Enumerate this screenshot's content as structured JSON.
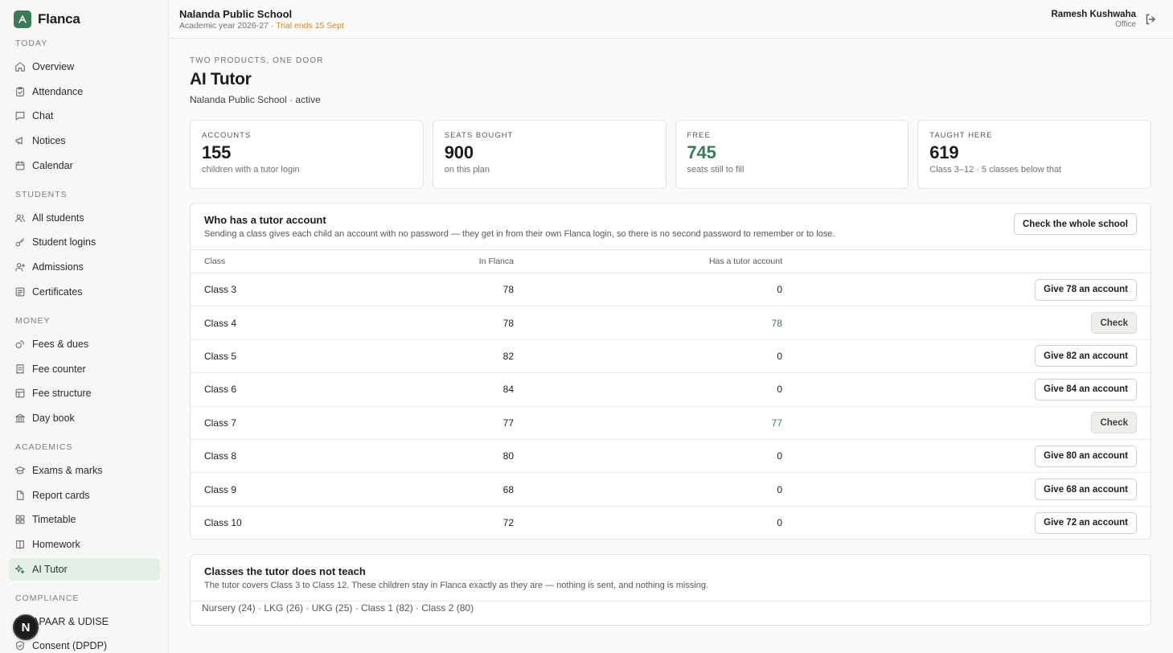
{
  "brand": {
    "name": "Flanca",
    "accent": "#3d7a56"
  },
  "header": {
    "school_name": "Nalanda Public School",
    "academic_year": "Academic year 2026-27",
    "separator": " · ",
    "trial": "Trial ends 15 Sept",
    "user_name": "Ramesh Kushwaha",
    "user_role": "Office"
  },
  "sidebar": {
    "sections": [
      {
        "label": "Today",
        "items": [
          {
            "label": "Overview",
            "icon": "home-icon"
          },
          {
            "label": "Attendance",
            "icon": "clipboard-check-icon"
          },
          {
            "label": "Chat",
            "icon": "chat-icon"
          },
          {
            "label": "Notices",
            "icon": "megaphone-icon"
          },
          {
            "label": "Calendar",
            "icon": "calendar-icon"
          }
        ]
      },
      {
        "label": "Students",
        "items": [
          {
            "label": "All students",
            "icon": "users-icon"
          },
          {
            "label": "Student logins",
            "icon": "key-icon"
          },
          {
            "label": "Admissions",
            "icon": "user-plus-icon"
          },
          {
            "label": "Certificates",
            "icon": "certificate-icon"
          }
        ]
      },
      {
        "label": "Money",
        "items": [
          {
            "label": "Fees & dues",
            "icon": "coins-icon"
          },
          {
            "label": "Fee counter",
            "icon": "receipt-icon"
          },
          {
            "label": "Fee structure",
            "icon": "table-icon"
          },
          {
            "label": "Day book",
            "icon": "bank-icon"
          }
        ]
      },
      {
        "label": "Academics",
        "items": [
          {
            "label": "Exams & marks",
            "icon": "graduation-cap-icon"
          },
          {
            "label": "Report cards",
            "icon": "document-icon"
          },
          {
            "label": "Timetable",
            "icon": "grid-icon"
          },
          {
            "label": "Homework",
            "icon": "book-icon"
          },
          {
            "label": "AI Tutor",
            "icon": "sparkles-icon",
            "active": true
          }
        ]
      },
      {
        "label": "Compliance",
        "items": [
          {
            "label": "APAAR & UDISE",
            "icon": "id-card-icon"
          },
          {
            "label": "Consent (DPDP)",
            "icon": "shield-check-icon"
          }
        ]
      }
    ],
    "avatar_letter": "N"
  },
  "page": {
    "eyebrow": "Two products, one door",
    "title": "AI Tutor",
    "subtitle": "Nalanda Public School · active"
  },
  "stats": [
    {
      "label": "Accounts",
      "value": "155",
      "note": "children with a tutor login"
    },
    {
      "label": "Seats bought",
      "value": "900",
      "note": "on this plan"
    },
    {
      "label": "Free",
      "value": "745",
      "note": "seats still to fill",
      "highlight": true
    },
    {
      "label": "Taught here",
      "value": "619",
      "note": "Class 3–12 · 5 classes below that"
    }
  ],
  "accounts_card": {
    "title": "Who has a tutor account",
    "description": "Sending a class gives each child an account with no password — they get in from their own Flanca login, so there is no second password to remember or to lose.",
    "check_all_label": "Check the whole school",
    "columns": {
      "class": "Class",
      "in_flanca": "In Flanca",
      "has_account": "Has a tutor account"
    },
    "rows": [
      {
        "class": "Class 3",
        "in_flanca": "78",
        "has_account": "0",
        "action": "Give 78 an account",
        "done": false
      },
      {
        "class": "Class 4",
        "in_flanca": "78",
        "has_account": "78",
        "action": "Check",
        "done": true
      },
      {
        "class": "Class 5",
        "in_flanca": "82",
        "has_account": "0",
        "action": "Give 82 an account",
        "done": false
      },
      {
        "class": "Class 6",
        "in_flanca": "84",
        "has_account": "0",
        "action": "Give 84 an account",
        "done": false
      },
      {
        "class": "Class 7",
        "in_flanca": "77",
        "has_account": "77",
        "action": "Check",
        "done": true
      },
      {
        "class": "Class 8",
        "in_flanca": "80",
        "has_account": "0",
        "action": "Give 80 an account",
        "done": false
      },
      {
        "class": "Class 9",
        "in_flanca": "68",
        "has_account": "0",
        "action": "Give 68 an account",
        "done": false
      },
      {
        "class": "Class 10",
        "in_flanca": "72",
        "has_account": "0",
        "action": "Give 72 an account",
        "done": false
      }
    ]
  },
  "not_taught_card": {
    "title": "Classes the tutor does not teach",
    "description": "The tutor covers Class 3 to Class 12. These children stay in Flanca exactly as they are — nothing is sent, and nothing is missing.",
    "list": "Nursery (24) · LKG (26) · UKG (25) · Class 1 (82) · Class 2 (80)"
  }
}
